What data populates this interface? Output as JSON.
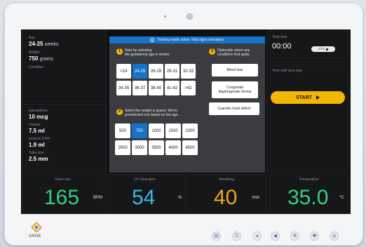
{
  "banner": {
    "text": "Training mode active. Vital signs simulated."
  },
  "patient": {
    "age_label": "Age",
    "age_value": "24-25",
    "age_unit": "weeks",
    "weight_label": "Weight",
    "weight_value": "750",
    "weight_unit": "grams",
    "condition_label": "Condition"
  },
  "meds": {
    "epi_label": "Epinephrine",
    "epi_value": "10 mcg",
    "volume_label": "Volume",
    "volume_value": "7.5 ml",
    "saline_label": "Isotonic 0.9%",
    "saline_value": "1.9 ml",
    "tube_label": "Tube size",
    "tube_value": "2.5 mm"
  },
  "step1": {
    "num": "1",
    "text_l1": "Start by selecting",
    "text_l2": "the gestational age in weeks:"
  },
  "ages": [
    "<24",
    "24-25",
    "26-28",
    "29-31",
    "32-33",
    "34-35",
    "36-37",
    "38-40",
    "41-42",
    ">42"
  ],
  "selected_age": "24-25",
  "step2": {
    "num": "2",
    "text_l1": "Select the weight in grams. We've",
    "text_l2": "preselected one based on the age."
  },
  "weights": [
    "500",
    "750",
    "1000",
    "1500",
    "2000",
    "2500",
    "3000",
    "3500",
    "4000",
    "4500"
  ],
  "selected_weight": "750",
  "step3": {
    "num": "3",
    "text_l1": "Optionally select any",
    "text_l2": "conditions that apply"
  },
  "conditions": {
    "c1": "Blood loss",
    "c2_l1": "Congenital",
    "c2_l2": "diaphragmatic hernia",
    "c3": "Cyanotic heart defect"
  },
  "timer": {
    "label": "Total time",
    "value": "00:00",
    "pause_label": "STOP"
  },
  "until": {
    "label": "Time until next step"
  },
  "start": {
    "label": "START"
  },
  "vitals": {
    "hr": {
      "label": "Heart rate",
      "value": "165",
      "unit": "BPM",
      "color": "#35d07f"
    },
    "o2": {
      "label": "O2 Saturation",
      "value": "54",
      "unit": "%",
      "color": "#38b6e6"
    },
    "br": {
      "label": "Breathing",
      "value": "40",
      "unit": "/min",
      "color": "#f0a81c"
    },
    "temp": {
      "label": "Temperature",
      "value": "35.0",
      "unit": "°C",
      "color": "#35d07f"
    }
  },
  "brand": {
    "name": "ARNE"
  },
  "controls": [
    "settings-icon",
    "power-icon",
    "volume-low-icon",
    "volume-high-icon",
    "brightness-low-icon",
    "brightness-high-icon",
    "help-icon"
  ]
}
